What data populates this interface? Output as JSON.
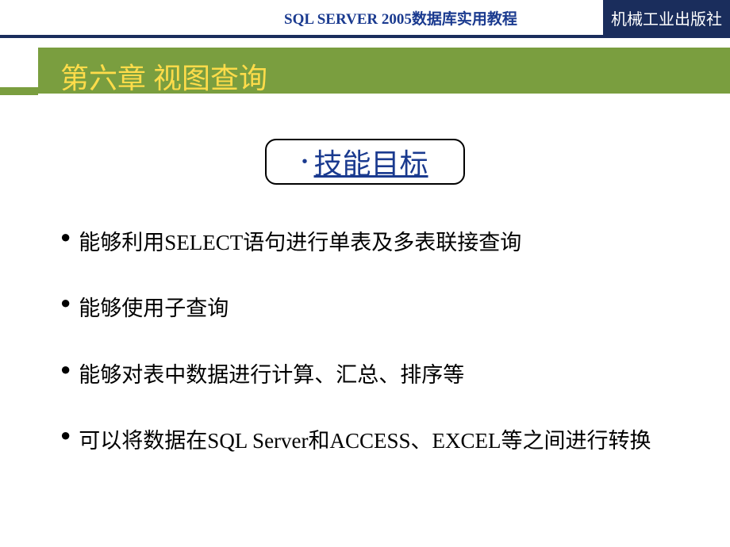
{
  "header": {
    "title": "SQL SERVER 2005数据库实用教程",
    "publisher": "机械工业出版社"
  },
  "chapter": {
    "title": "第六章  视图查询"
  },
  "skill_target": {
    "label": "技能目标"
  },
  "bullets": [
    "能够利用SELECT语句进行单表及多表联接查询",
    "能够使用子查询",
    "能够对表中数据进行计算、汇总、排序等",
    "可以将数据在SQL Server和ACCESS、EXCEL等之间进行转换"
  ]
}
